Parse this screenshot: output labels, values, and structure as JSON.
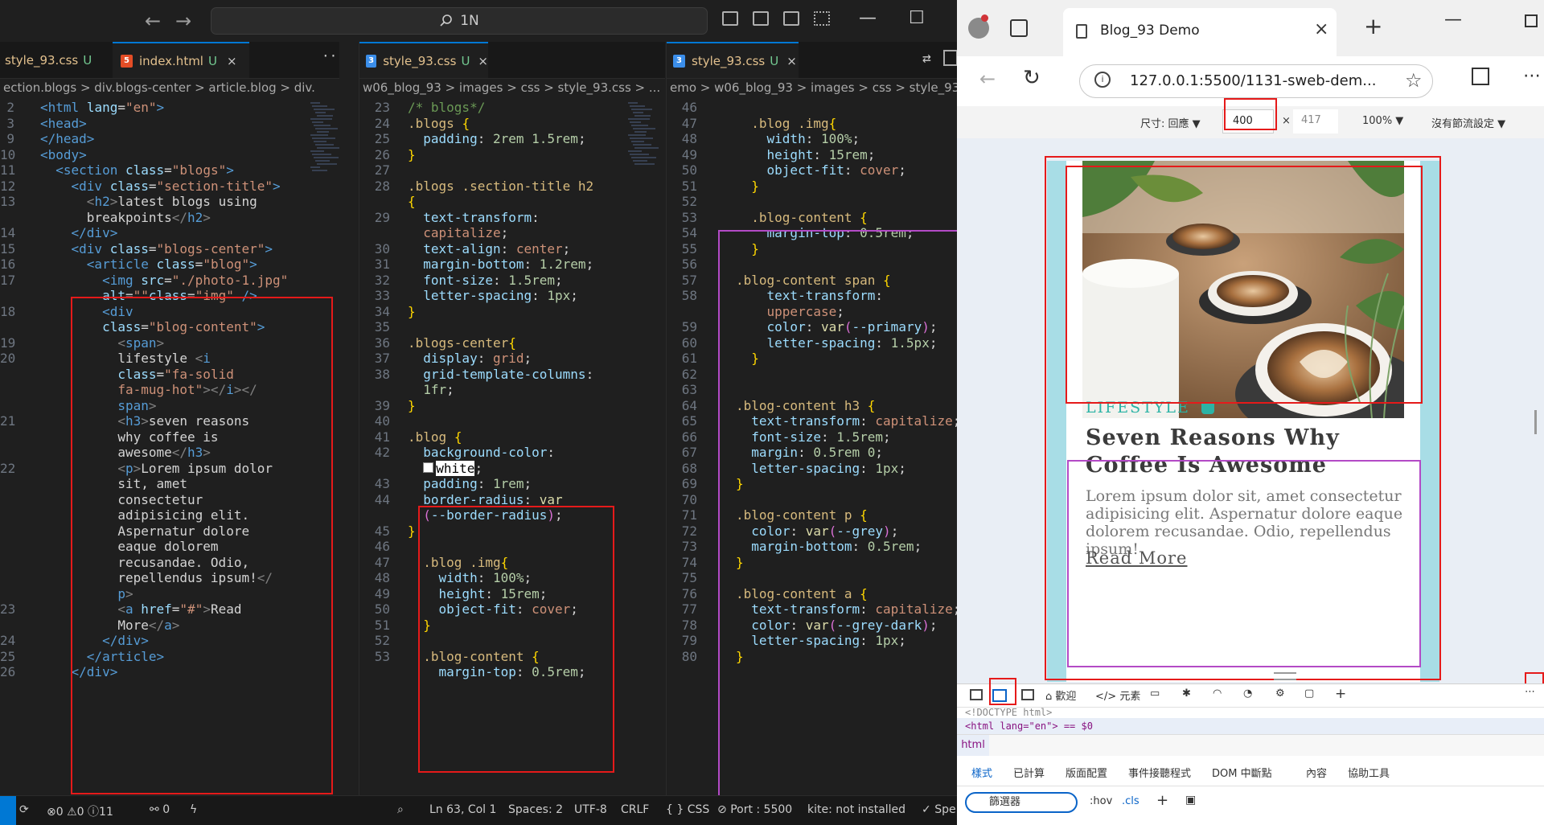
{
  "vscode": {
    "search_label": "1N",
    "left_pane": {
      "tabs": [
        {
          "label": "style_93.css",
          "mod": "U"
        },
        {
          "label": "index.html",
          "mod": "U"
        }
      ],
      "breadcrumb": "ection.blogs > div.blogs-center > article.blog > div.",
      "lines": [
        {
          "n": "2",
          "html": "<span class='t'>&lt;html</span> <span class='a'>lang</span><span class='w'>=</span><span class='s'>\"en\"</span><span class='t'>&gt;</span>"
        },
        {
          "n": "3",
          "html": "<span class='t'>&lt;head&gt;</span>"
        },
        {
          "n": "9",
          "html": "<span class='t'>&lt;/head&gt;</span>"
        },
        {
          "n": "10",
          "html": "<span class='t'>&lt;body&gt;</span>"
        },
        {
          "n": "11",
          "html": "  <span class='t'>&lt;section</span> <span class='a'>class</span><span class='w'>=</span><span class='s'>\"blogs\"</span><span class='t'>&gt;</span>"
        },
        {
          "n": "12",
          "html": "    <span class='t'>&lt;div</span> <span class='a'>class</span><span class='w'>=</span><span class='s'>\"section-title\"</span><span class='t'>&gt;</span>"
        },
        {
          "n": "13",
          "html": "      <span class='p'>&lt;</span><span class='t'>h2</span><span class='p'>&gt;</span><span class='w'>latest blogs using</span>"
        },
        {
          "n": "",
          "html": "      <span class='w'>breakpoints</span><span class='p'>&lt;/</span><span class='t'>h2</span><span class='p'>&gt;</span>"
        },
        {
          "n": "14",
          "html": "    <span class='t'>&lt;/div&gt;</span>"
        },
        {
          "n": "15",
          "html": "    <span class='t'>&lt;div</span> <span class='a'>class</span><span class='w'>=</span><span class='s'>\"blogs-center\"</span><span class='t'>&gt;</span>"
        },
        {
          "n": "16",
          "html": "      <span class='t'>&lt;article</span> <span class='a'>class</span><span class='w'>=</span><span class='s'>\"blog\"</span><span class='t'>&gt;</span>"
        },
        {
          "n": "17",
          "html": "        <span class='t'>&lt;img</span> <span class='a'>src</span><span class='w'>=</span><span class='s'>\"./photo-1.jpg\"</span>"
        },
        {
          "n": "",
          "html": "        <span class='a'>alt</span><span class='w'>=</span><span class='s'>\"\"</span><span class='a'>class</span><span class='w'>=</span><span class='s'>\"img\"</span> <span class='t'>/&gt;</span>"
        },
        {
          "n": "18",
          "html": "        <span class='t'>&lt;div</span>"
        },
        {
          "n": "",
          "html": "        <span class='a'>class</span><span class='w'>=</span><span class='s'>\"blog-content\"</span><span class='t'>&gt;</span>"
        },
        {
          "n": "19",
          "html": "          <span class='p'>&lt;</span><span class='t'>span</span><span class='p'>&gt;</span>"
        },
        {
          "n": "20",
          "html": "          <span class='w'>lifestyle </span><span class='p'>&lt;</span><span class='t'>i</span>"
        },
        {
          "n": "",
          "html": "          <span class='a'>class</span><span class='w'>=</span><span class='s'>\"fa-solid</span>"
        },
        {
          "n": "",
          "html": "          <span class='s'>fa-mug-hot\"</span><span class='p'>&gt;&lt;/</span><span class='t'>i</span><span class='p'>&gt;&lt;/</span>"
        },
        {
          "n": "",
          "html": "          <span class='t'>span</span><span class='p'>&gt;</span>"
        },
        {
          "n": "21",
          "html": "          <span class='p'>&lt;</span><span class='t'>h3</span><span class='p'>&gt;</span><span class='w'>seven reasons</span>"
        },
        {
          "n": "",
          "html": "          <span class='w'>why coffee is</span>"
        },
        {
          "n": "",
          "html": "          <span class='w'>awesome</span><span class='p'>&lt;/</span><span class='t'>h3</span><span class='p'>&gt;</span>"
        },
        {
          "n": "22",
          "html": "          <span class='p'>&lt;</span><span class='t'>p</span><span class='p'>&gt;</span><span class='w'>Lorem ipsum dolor</span>"
        },
        {
          "n": "",
          "html": "          <span class='w'>sit, amet</span>"
        },
        {
          "n": "",
          "html": "          <span class='w'>consectetur</span>"
        },
        {
          "n": "",
          "html": "          <span class='w'>adipisicing elit.</span>"
        },
        {
          "n": "",
          "html": "          <span class='w'>Aspernatur dolore</span>"
        },
        {
          "n": "",
          "html": "          <span class='w'>eaque dolorem</span>"
        },
        {
          "n": "",
          "html": "          <span class='w'>recusandae. Odio,</span>"
        },
        {
          "n": "",
          "html": "          <span class='w'>repellendus ipsum!</span><span class='p'>&lt;/</span>"
        },
        {
          "n": "",
          "html": "          <span class='t'>p</span><span class='p'>&gt;</span>"
        },
        {
          "n": "23",
          "html": "          <span class='p'>&lt;</span><span class='t'>a</span> <span class='a'>href</span><span class='w'>=</span><span class='s'>\"#\"</span><span class='p'>&gt;</span><span class='w'>Read</span>"
        },
        {
          "n": "",
          "html": "          <span class='w'>More</span><span class='p'>&lt;/</span><span class='t'>a</span><span class='p'>&gt;</span>"
        },
        {
          "n": "24",
          "html": "        <span class='t'>&lt;/div&gt;</span>"
        },
        {
          "n": "25",
          "html": "      <span class='t'>&lt;/article&gt;</span>"
        },
        {
          "n": "26",
          "html": "    <span class='t'>&lt;/div&gt;</span>"
        }
      ]
    },
    "mid_pane": {
      "tabs": [
        {
          "label": "style_93.css",
          "mod": "U"
        }
      ],
      "breadcrumb": "w06_blog_93 > images > css > style_93.css > ...",
      "lines": [
        {
          "n": "23",
          "html": "<span class='cm'>/* blogs*/</span>"
        },
        {
          "n": "24",
          "html": "<span class='sel'>.blogs</span> <span class='y'>{</span>"
        },
        {
          "n": "25",
          "html": "  <span class='kw'>padding</span><span class='w'>: </span><span class='n'>2rem 1.5rem</span><span class='w'>;</span>"
        },
        {
          "n": "26",
          "html": "<span class='y'>}</span>"
        },
        {
          "n": "27",
          "html": ""
        },
        {
          "n": "28",
          "html": "<span class='sel'>.blogs .section-title h2</span>"
        },
        {
          "n": "",
          "html": "<span class='y'>{</span>"
        },
        {
          "n": "29",
          "html": "  <span class='kw'>text-transform</span><span class='w'>:</span>"
        },
        {
          "n": "",
          "html": "  <span class='v'>capitalize</span><span class='w'>;</span>"
        },
        {
          "n": "30",
          "html": "  <span class='kw'>text-align</span><span class='w'>: </span><span class='v'>center</span><span class='w'>;</span>"
        },
        {
          "n": "31",
          "html": "  <span class='kw'>margin-bottom</span><span class='w'>: </span><span class='n'>1.2rem</span><span class='w'>;</span>"
        },
        {
          "n": "32",
          "html": "  <span class='kw'>font-size</span><span class='w'>: </span><span class='n'>1.5rem</span><span class='w'>;</span>"
        },
        {
          "n": "33",
          "html": "  <span class='kw'>letter-spacing</span><span class='w'>: </span><span class='n'>1px</span><span class='w'>;</span>"
        },
        {
          "n": "34",
          "html": "<span class='y'>}</span>"
        },
        {
          "n": "35",
          "html": ""
        },
        {
          "n": "36",
          "html": "<span class='sel'>.blogs-center</span><span class='y'>{</span>"
        },
        {
          "n": "37",
          "html": "  <span class='kw'>display</span><span class='w'>: </span><span class='v'>grid</span><span class='w'>;</span>"
        },
        {
          "n": "38",
          "html": "  <span class='kw'>grid-template-columns</span><span class='w'>:</span>"
        },
        {
          "n": "",
          "html": "  <span class='n'>1fr</span><span class='w'>;</span>"
        },
        {
          "n": "39",
          "html": "<span class='y'>}</span>"
        },
        {
          "n": "40",
          "html": ""
        },
        {
          "n": "41",
          "html": "<span class='sel'>.blog</span> <span class='y'>{</span>"
        },
        {
          "n": "42",
          "html": "  <span class='kw'>background-color</span><span class='w'>:</span>"
        },
        {
          "n": "",
          "html": "  <span style='display:inline-block;width:11px;height:11px;background:#fff;border:1px solid #888;margin-right:3px;'></span><span class='v' style='background:#fff;color:#000;'>white</span><span class='w'>;</span>"
        },
        {
          "n": "43",
          "html": "  <span class='kw'>padding</span><span class='w'>: </span><span class='n'>1rem</span><span class='w'>;</span>"
        },
        {
          "n": "44",
          "html": "  <span class='kw'>border-radius</span><span class='w'>: </span><span class='fn'>var</span>"
        },
        {
          "n": "",
          "html": "  <span class='pk'>(</span><span class='a'>--border-radius</span><span class='pk'>)</span><span class='w'>;</span>"
        },
        {
          "n": "45",
          "html": "<span class='y'>}</span>"
        },
        {
          "n": "46",
          "html": ""
        },
        {
          "n": "47",
          "html": "  <span class='sel'>.blog .img</span><span class='y'>{</span>"
        },
        {
          "n": "48",
          "html": "    <span class='kw'>width</span><span class='w'>: </span><span class='n'>100%</span><span class='w'>;</span>"
        },
        {
          "n": "49",
          "html": "    <span class='kw'>height</span><span class='w'>: </span><span class='n'>15rem</span><span class='w'>;</span>"
        },
        {
          "n": "50",
          "html": "    <span class='kw'>object-fit</span><span class='w'>: </span><span class='v'>cover</span><span class='w'>;</span>"
        },
        {
          "n": "51",
          "html": "  <span class='y'>}</span>"
        },
        {
          "n": "52",
          "html": ""
        },
        {
          "n": "53",
          "html": "  <span class='sel'>.blog-content</span> <span class='y'>{</span>"
        },
        {
          "n": "",
          "html": "    <span class='kw'>margin-top</span><span class='w'>: </span><span class='n'>0.5rem</span><span class='w'>;</span>"
        }
      ]
    },
    "right_pane": {
      "tabs": [
        {
          "label": "style_93.css",
          "mod": "U"
        }
      ],
      "breadcrumb": "emo > w06_blog_93 > images > css > style_93.",
      "lines": [
        {
          "n": "46",
          "html": ""
        },
        {
          "n": "47",
          "html": "  <span class='sel'>.blog .img</span><span class='y'>{</span>"
        },
        {
          "n": "48",
          "html": "    <span class='kw'>width</span><span class='w'>: </span><span class='n'>100%</span><span class='w'>;</span>"
        },
        {
          "n": "49",
          "html": "    <span class='kw'>height</span><span class='w'>: </span><span class='n'>15rem</span><span class='w'>;</span>"
        },
        {
          "n": "50",
          "html": "    <span class='kw'>object-fit</span><span class='w'>: </span><span class='v'>cover</span><span class='w'>;</span>"
        },
        {
          "n": "51",
          "html": "  <span class='y'>}</span>"
        },
        {
          "n": "52",
          "html": ""
        },
        {
          "n": "53",
          "html": "  <span class='sel'>.blog-content</span> <span class='y'>{</span>"
        },
        {
          "n": "54",
          "html": "    <span class='kw'>margin-top</span><span class='w'>: </span><span class='n'>0.5rem</span><span class='w'>;</span>"
        },
        {
          "n": "55",
          "html": "  <span class='y'>}</span>"
        },
        {
          "n": "56",
          "html": ""
        },
        {
          "n": "57",
          "html": "<span class='sel'>.blog-content span</span> <span class='y'>{</span>"
        },
        {
          "n": "58",
          "html": "    <span class='kw'>text-transform</span><span class='w'>:</span>"
        },
        {
          "n": "",
          "html": "    <span class='v'>uppercase</span><span class='w'>;</span>"
        },
        {
          "n": "59",
          "html": "    <span class='kw'>color</span><span class='w'>: </span><span class='fn'>var</span><span class='pk'>(</span><span class='a'>--primary</span><span class='pk'>)</span><span class='w'>;</span>"
        },
        {
          "n": "60",
          "html": "    <span class='kw'>letter-spacing</span><span class='w'>: </span><span class='n'>1.5px</span><span class='w'>;</span>"
        },
        {
          "n": "61",
          "html": "  <span class='y'>}</span>"
        },
        {
          "n": "62",
          "html": ""
        },
        {
          "n": "63",
          "html": ""
        },
        {
          "n": "64",
          "html": "<span class='sel'>.blog-content h3</span> <span class='y'>{</span>"
        },
        {
          "n": "65",
          "html": "  <span class='kw'>text-transform</span><span class='w'>: </span><span class='v'>capitalize</span><span class='w'>;</span>"
        },
        {
          "n": "66",
          "html": "  <span class='kw'>font-size</span><span class='w'>: </span><span class='n'>1.5rem</span><span class='w'>;</span>"
        },
        {
          "n": "67",
          "html": "  <span class='kw'>margin</span><span class='w'>: </span><span class='n'>0.5rem 0</span><span class='w'>;</span>"
        },
        {
          "n": "68",
          "html": "  <span class='kw'>letter-spacing</span><span class='w'>: </span><span class='n'>1px</span><span class='w'>;</span>"
        },
        {
          "n": "69",
          "html": "<span class='y'>}</span>"
        },
        {
          "n": "70",
          "html": ""
        },
        {
          "n": "71",
          "html": "<span class='sel'>.blog-content p</span> <span class='y'>{</span>"
        },
        {
          "n": "72",
          "html": "  <span class='kw'>color</span><span class='w'>: </span><span class='fn'>var</span><span class='pk'>(</span><span class='a'>--grey</span><span class='pk'>)</span><span class='w'>;</span>"
        },
        {
          "n": "73",
          "html": "  <span class='kw'>margin-bottom</span><span class='w'>: </span><span class='n'>0.5rem</span><span class='w'>;</span>"
        },
        {
          "n": "74",
          "html": "<span class='y'>}</span>"
        },
        {
          "n": "75",
          "html": ""
        },
        {
          "n": "76",
          "html": "<span class='sel'>.blog-content a</span> <span class='y'>{</span>"
        },
        {
          "n": "77",
          "html": "  <span class='kw'>text-transform</span><span class='w'>: </span><span class='v'>capitalize</span><span class='w'>;</span>"
        },
        {
          "n": "78",
          "html": "  <span class='kw'>color</span><span class='w'>: </span><span class='fn'>var</span><span class='pk'>(</span><span class='a'>--grey-dark</span><span class='pk'>)</span><span class='w'>;</span>"
        },
        {
          "n": "79",
          "html": "  <span class='kw'>letter-spacing</span><span class='w'>: </span><span class='n'>1px</span><span class='w'>;</span>"
        },
        {
          "n": "80",
          "html": "<span class='y'>}</span>"
        }
      ]
    },
    "status": {
      "errors": "0",
      "warnings": "0",
      "info": "11",
      "ports": "0",
      "position": "Ln 63, Col 1",
      "spaces": "Spaces: 2",
      "encoding": "UTF-8",
      "eol": "CRLF",
      "lang": "CSS",
      "port": "Port : 5500",
      "kite": "kite: not installed",
      "spell": "Spe"
    }
  },
  "browser": {
    "tab_title": "Blog_93 Demo",
    "url": "127.0.0.1:5500/1131-sweb-dem...",
    "device_toolbar": {
      "dimensions_label": "尺寸: 回應",
      "width": "400",
      "times": "×",
      "height": "417",
      "zoom": "100%",
      "throttle": "沒有節流設定"
    },
    "page": {
      "category": "LIFESTYLE",
      "title": "Seven Reasons Why Coffee Is Awesome",
      "body": "Lorem ipsum dolor sit, amet consectetur adipisicing elit. Aspernatur dolore eaque dolorem recusandae. Odio, repellendus ipsum!",
      "link": "Read More"
    },
    "devtools": {
      "tabs": [
        "歡迎",
        "元素"
      ],
      "dom_line1": "<!DOCTYPE html>",
      "dom_line2": "<html lang=\"en\"> == $0",
      "crumb": "html",
      "subtabs": [
        "樣式",
        "已計算",
        "版面配置",
        "事件接聽程式",
        "DOM 中斷點",
        "內容",
        "協助工具"
      ],
      "filter": "篩選器",
      "hov": ":hov",
      "cls": ".cls"
    }
  }
}
